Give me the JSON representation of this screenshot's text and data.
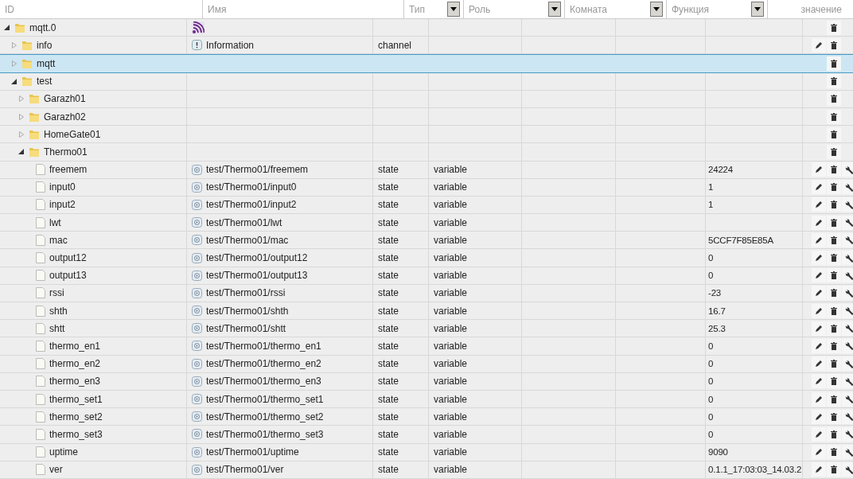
{
  "columns": [
    {
      "label": "ID",
      "filter": false
    },
    {
      "label": "Имя",
      "filter": false
    },
    {
      "label": "Тип",
      "filter": true
    },
    {
      "label": "Роль",
      "filter": true
    },
    {
      "label": "Комната",
      "filter": true
    },
    {
      "label": "Функция",
      "filter": true
    },
    {
      "label": "значение",
      "filter": false
    }
  ],
  "tree": [
    {
      "id": "mqtt.0",
      "kind": "adapter",
      "expanded": true,
      "selected": false,
      "editable": false,
      "configurable": false,
      "children": [
        {
          "id": "info",
          "kind": "channel",
          "expanded": false,
          "selected": false,
          "name": "Information",
          "type": "channel",
          "editable": true,
          "configurable": false
        },
        {
          "id": "mqtt",
          "kind": "folder",
          "expanded": false,
          "selected": true,
          "editable": false,
          "configurable": false
        },
        {
          "id": "test",
          "kind": "folder",
          "expanded": true,
          "selected": false,
          "editable": false,
          "configurable": false,
          "children": [
            {
              "id": "Garazh01",
              "kind": "folder",
              "expanded": false,
              "selected": false,
              "editable": false,
              "configurable": false
            },
            {
              "id": "Garazh02",
              "kind": "folder",
              "expanded": false,
              "selected": false,
              "editable": false,
              "configurable": false
            },
            {
              "id": "HomeGate01",
              "kind": "folder",
              "expanded": false,
              "selected": false,
              "editable": false,
              "configurable": false
            },
            {
              "id": "Thermo01",
              "kind": "folder",
              "expanded": true,
              "selected": false,
              "editable": false,
              "configurable": false,
              "children": [
                {
                  "id": "freemem",
                  "kind": "state",
                  "selected": false,
                  "name": "test/Thermo01/freemem",
                  "type": "state",
                  "role": "variable",
                  "value": "24224",
                  "editable": true,
                  "configurable": true
                },
                {
                  "id": "input0",
                  "kind": "state",
                  "selected": false,
                  "name": "test/Thermo01/input0",
                  "type": "state",
                  "role": "variable",
                  "value": "1",
                  "editable": true,
                  "configurable": true
                },
                {
                  "id": "input2",
                  "kind": "state",
                  "selected": false,
                  "name": "test/Thermo01/input2",
                  "type": "state",
                  "role": "variable",
                  "value": "1",
                  "editable": true,
                  "configurable": true
                },
                {
                  "id": "lwt",
                  "kind": "state",
                  "selected": false,
                  "name": "test/Thermo01/lwt",
                  "type": "state",
                  "role": "variable",
                  "editable": true,
                  "configurable": true
                },
                {
                  "id": "mac",
                  "kind": "state",
                  "selected": false,
                  "name": "test/Thermo01/mac",
                  "type": "state",
                  "role": "variable",
                  "value": "5CCF7F85E85A",
                  "editable": true,
                  "configurable": true
                },
                {
                  "id": "output12",
                  "kind": "state",
                  "selected": false,
                  "name": "test/Thermo01/output12",
                  "type": "state",
                  "role": "variable",
                  "value": "0",
                  "editable": true,
                  "configurable": true
                },
                {
                  "id": "output13",
                  "kind": "state",
                  "selected": false,
                  "name": "test/Thermo01/output13",
                  "type": "state",
                  "role": "variable",
                  "value": "0",
                  "editable": true,
                  "configurable": true
                },
                {
                  "id": "rssi",
                  "kind": "state",
                  "selected": false,
                  "name": "test/Thermo01/rssi",
                  "type": "state",
                  "role": "variable",
                  "value": "-23",
                  "editable": true,
                  "configurable": true
                },
                {
                  "id": "shth",
                  "kind": "state",
                  "selected": false,
                  "name": "test/Thermo01/shth",
                  "type": "state",
                  "role": "variable",
                  "value": "16.7",
                  "editable": true,
                  "configurable": true
                },
                {
                  "id": "shtt",
                  "kind": "state",
                  "selected": false,
                  "name": "test/Thermo01/shtt",
                  "type": "state",
                  "role": "variable",
                  "value": "25.3",
                  "editable": true,
                  "configurable": true
                },
                {
                  "id": "thermo_en1",
                  "kind": "state",
                  "selected": false,
                  "name": "test/Thermo01/thermo_en1",
                  "type": "state",
                  "role": "variable",
                  "value": "0",
                  "editable": true,
                  "configurable": true
                },
                {
                  "id": "thermo_en2",
                  "kind": "state",
                  "selected": false,
                  "name": "test/Thermo01/thermo_en2",
                  "type": "state",
                  "role": "variable",
                  "value": "0",
                  "editable": true,
                  "configurable": true
                },
                {
                  "id": "thermo_en3",
                  "kind": "state",
                  "selected": false,
                  "name": "test/Thermo01/thermo_en3",
                  "type": "state",
                  "role": "variable",
                  "value": "0",
                  "editable": true,
                  "configurable": true
                },
                {
                  "id": "thermo_set1",
                  "kind": "state",
                  "selected": false,
                  "name": "test/Thermo01/thermo_set1",
                  "type": "state",
                  "role": "variable",
                  "value": "0",
                  "editable": true,
                  "configurable": true
                },
                {
                  "id": "thermo_set2",
                  "kind": "state",
                  "selected": false,
                  "name": "test/Thermo01/thermo_set2",
                  "type": "state",
                  "role": "variable",
                  "value": "0",
                  "editable": true,
                  "configurable": true
                },
                {
                  "id": "thermo_set3",
                  "kind": "state",
                  "selected": false,
                  "name": "test/Thermo01/thermo_set3",
                  "type": "state",
                  "role": "variable",
                  "value": "0",
                  "editable": true,
                  "configurable": true
                },
                {
                  "id": "uptime",
                  "kind": "state",
                  "selected": false,
                  "name": "test/Thermo01/uptime",
                  "type": "state",
                  "role": "variable",
                  "value": "9090",
                  "editable": true,
                  "configurable": true
                },
                {
                  "id": "ver",
                  "kind": "state",
                  "selected": false,
                  "name": "test/Thermo01/ver",
                  "type": "state",
                  "role": "variable",
                  "value": "0.1.1_17:03:03_14.03.2",
                  "editable": true,
                  "configurable": true
                }
              ]
            }
          ]
        }
      ]
    }
  ]
}
